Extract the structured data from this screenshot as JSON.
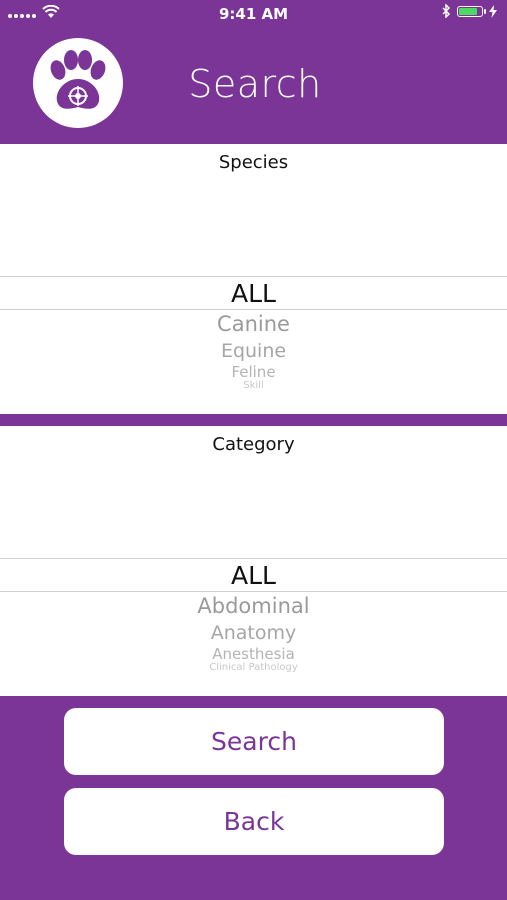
{
  "status": {
    "time": "9:41 AM"
  },
  "header": {
    "title": "Search"
  },
  "species": {
    "label": "Species",
    "selected": "ALL",
    "options": [
      "Canine",
      "Equine",
      "Feline",
      "Skill"
    ]
  },
  "category": {
    "label": "Category",
    "selected": "ALL",
    "options": [
      "Abdominal",
      "Anatomy",
      "Anesthesia",
      "Clinical Pathology"
    ]
  },
  "buttons": {
    "search": "Search",
    "back": "Back"
  },
  "colors": {
    "brand": "#7a3597",
    "battery": "#4cd964"
  }
}
